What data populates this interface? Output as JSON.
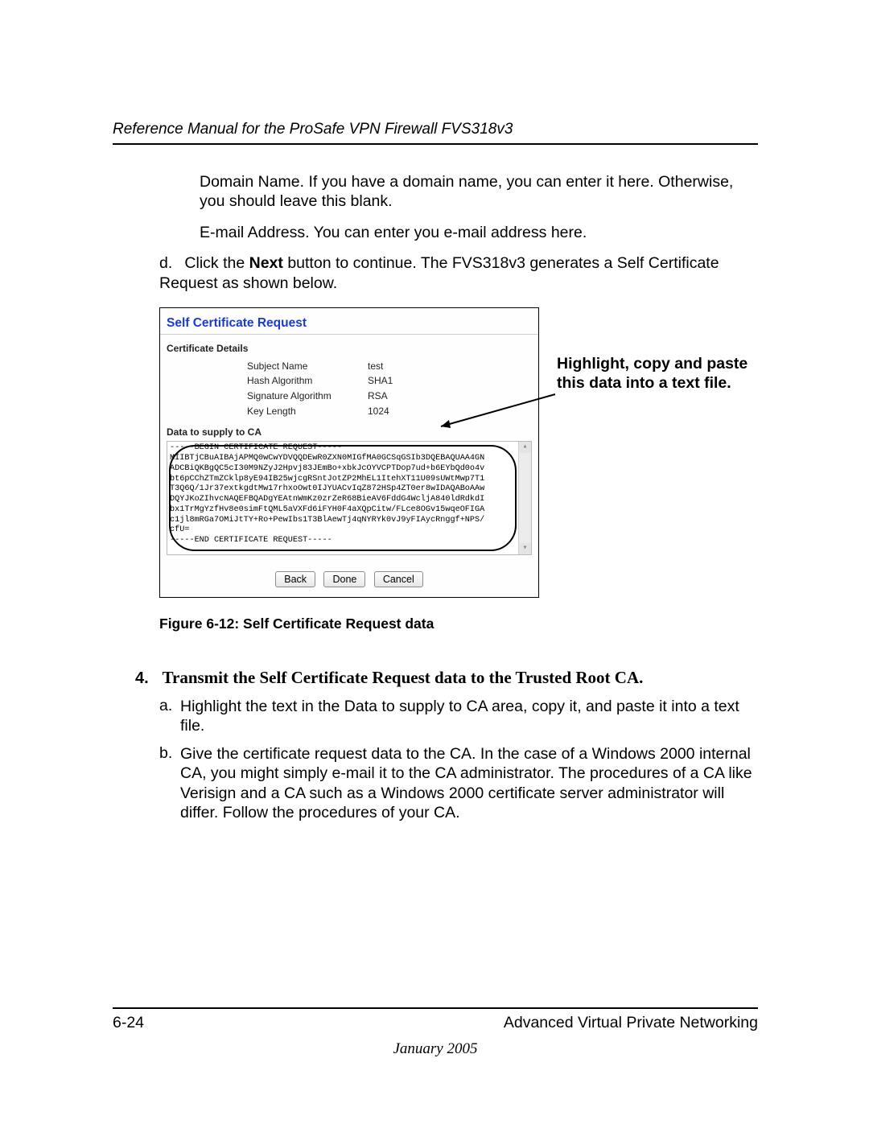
{
  "header": {
    "manual_title": "Reference Manual for the ProSafe VPN Firewall FVS318v3"
  },
  "para": {
    "domain": "Domain Name. If you have a domain name, you can enter it here. Otherwise, you should leave this blank.",
    "email": "E-mail Address. You can enter you e-mail address here."
  },
  "step_d": {
    "marker": "d.",
    "pre": "Click the ",
    "bold": "Next",
    "post": " button to continue. The FVS318v3 generates a Self Certificate Request as shown below."
  },
  "screenshot": {
    "title": "Self Certificate Request",
    "section_details": "Certificate Details",
    "rows": [
      {
        "label": "Subject Name",
        "value": "test"
      },
      {
        "label": "Hash Algorithm",
        "value": "SHA1"
      },
      {
        "label": "Signature Algorithm",
        "value": "RSA"
      },
      {
        "label": "Key Length",
        "value": "1024"
      }
    ],
    "data_supply_title": "Data to supply to CA",
    "csr_lines": [
      "-----BEGIN CERTIFICATE REQUEST-----",
      "MIIBTjCBuAIBAjAPMQ0wCwYDVQQDEwR0ZXN0MIGfMA0GCSqGSIb3DQEBAQUAA4GN",
      "ADCBiQKBgQC5cI30M9NZyJ2Hpvj83JEmBo+xbkJcOYVCPTDop7ud+b6EYbQd0o4v",
      "bt6pCChZTmZCklp8yE94IB25wjcgRSntJotZP2MhEL1ItehXT11U09sUWtMwp7T1",
      "T3Q6Q/1Jr37extkgdtMw17rhxoOwt0IJYUACvIqZ872HSp4ZT0er8wIDAQABoAAw",
      "DQYJKoZIhvcNAQEFBQADgYEAtnWmKz0zrZeR68BieAV6FddG4WcljA840ldRdkdI",
      "bx1TrMgYzfHv8e0simFtQML5aVXFd6iFYH0F4aXQpCitw/FLce8OGv15wqeOFIGA",
      "c1jl8mRGa7OMiJtTY+Ro+PewIbs1T3BlAewTj4qNYRYk0vJ9yFIAycRnggf+NPS/",
      "cfU=",
      "-----END CERTIFICATE REQUEST-----"
    ],
    "buttons": {
      "back": "Back",
      "done": "Done",
      "cancel": "Cancel"
    }
  },
  "callout": {
    "text": "Highlight, copy and paste this data into a text file."
  },
  "figure_caption": "Figure 6-12: Self Certificate Request data",
  "step4": {
    "num": "4.",
    "title": "Transmit the Self Certificate Request data to the Trusted Root CA."
  },
  "step4_sub": {
    "a": {
      "m": "a.",
      "t": "Highlight the text in the Data to supply to CA area, copy it, and paste it into a text file."
    },
    "b": {
      "m": "b.",
      "t": "Give the certificate request data to the CA. In the case of a Windows 2000 internal CA, you might simply e-mail it to the CA administrator. The procedures of a CA like Verisign and a CA such as a Windows 2000 certificate server administrator will differ. Follow the procedures of your CA."
    }
  },
  "footer": {
    "page_num": "6-24",
    "section": "Advanced Virtual Private Networking",
    "date": "January 2005"
  }
}
